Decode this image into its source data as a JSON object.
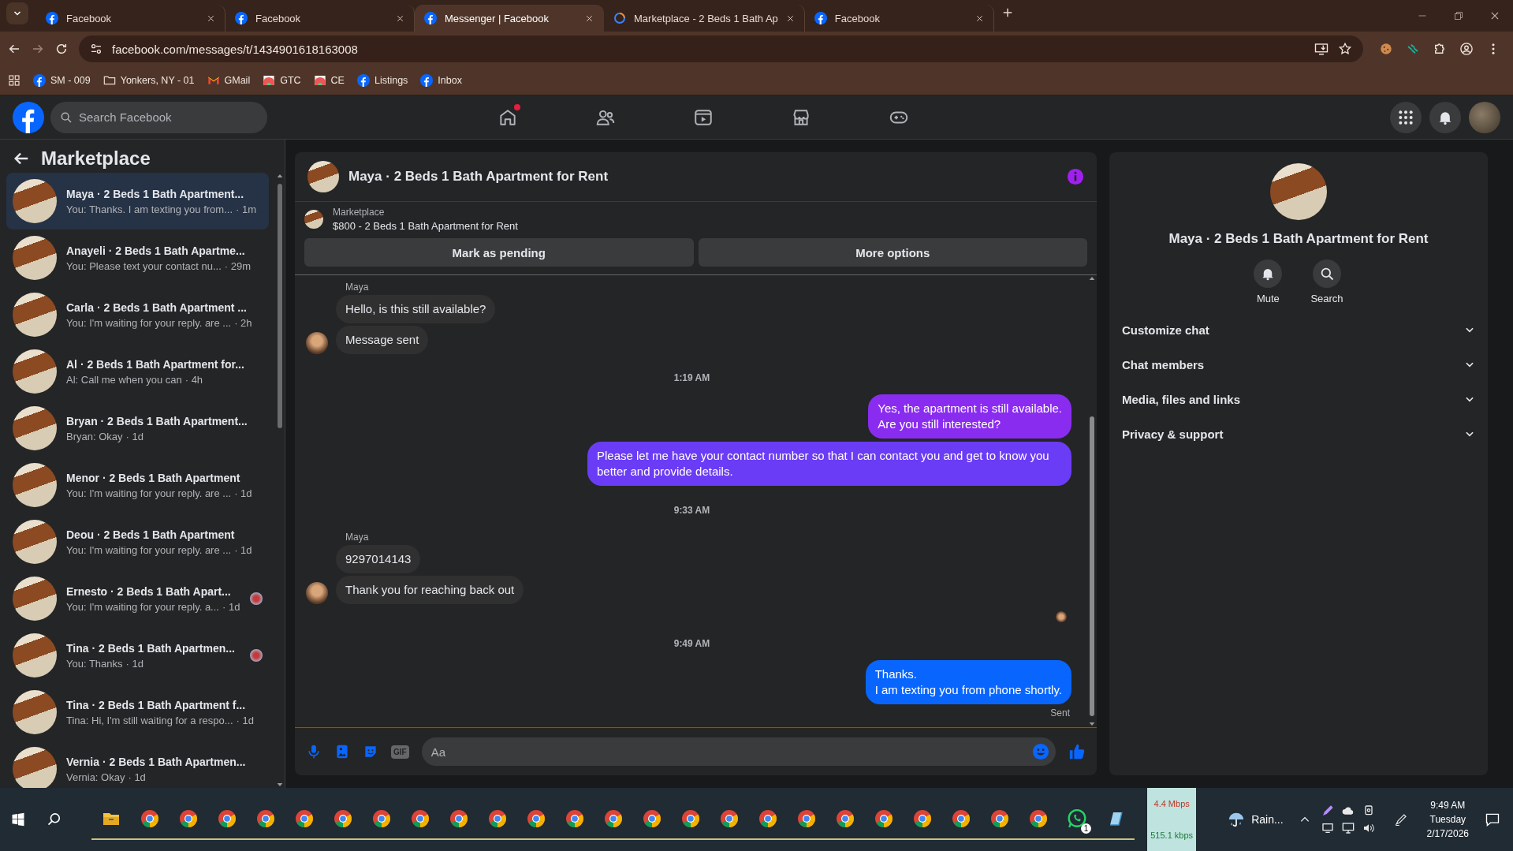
{
  "browser": {
    "tabs": [
      {
        "title": "Facebook",
        "kind": "facebook",
        "selected": false
      },
      {
        "title": "Facebook",
        "kind": "facebook",
        "selected": false
      },
      {
        "title": "Messenger | Facebook",
        "kind": "facebook",
        "selected": true
      },
      {
        "title": "Marketplace - 2 Beds 1 Bath Ap",
        "kind": "loading",
        "selected": false
      },
      {
        "title": "Facebook",
        "kind": "facebook",
        "selected": false
      }
    ],
    "url": "facebook.com/messages/t/1434901618163008",
    "bookmarks": [
      {
        "label": "SM - 009",
        "kind": "facebook"
      },
      {
        "label": "Yonkers, NY - 01",
        "kind": "folder"
      },
      {
        "label": "GMail",
        "kind": "gmail"
      },
      {
        "label": "GTC",
        "kind": "image"
      },
      {
        "label": "CE",
        "kind": "image"
      },
      {
        "label": "Listings",
        "kind": "facebook"
      },
      {
        "label": "Inbox",
        "kind": "facebook"
      }
    ]
  },
  "facebook_header": {
    "search_placeholder": "Search Facebook",
    "nav": [
      {
        "kind": "home",
        "notification_dot": true
      },
      {
        "kind": "friends",
        "notification_dot": false
      },
      {
        "kind": "video",
        "notification_dot": false
      },
      {
        "kind": "marketplace",
        "notification_dot": false
      },
      {
        "kind": "gaming",
        "notification_dot": false
      }
    ]
  },
  "sidebar": {
    "title": "Marketplace",
    "conversations": [
      {
        "title": "Maya · 2 Beds 1 Bath Apartment...",
        "preview": "You: Thanks. I am texting you from...",
        "time": "· 1m",
        "selected": true,
        "seen_avatar": false
      },
      {
        "title": "Anayeli · 2 Beds 1 Bath Apartme...",
        "preview": "You: Please text your contact nu...",
        "time": "· 29m",
        "selected": false,
        "seen_avatar": false
      },
      {
        "title": "Carla · 2 Beds 1 Bath Apartment ...",
        "preview": "You: I'm waiting for your reply. are ...",
        "time": "· 2h",
        "selected": false,
        "seen_avatar": false
      },
      {
        "title": "Al · 2 Beds 1 Bath Apartment for...",
        "preview": "Al: Call me when you can",
        "time": "· 4h",
        "selected": false,
        "seen_avatar": false
      },
      {
        "title": "Bryan · 2 Beds 1 Bath Apartment...",
        "preview": "Bryan: Okay",
        "time": "· 1d",
        "selected": false,
        "seen_avatar": false
      },
      {
        "title": "Menor · 2 Beds 1 Bath Apartment",
        "preview": "You: I'm waiting for your reply. are ...",
        "time": "· 1d",
        "selected": false,
        "seen_avatar": false
      },
      {
        "title": "Deou · 2 Beds 1 Bath Apartment",
        "preview": "You: I'm waiting for your reply. are ...",
        "time": "· 1d",
        "selected": false,
        "seen_avatar": false
      },
      {
        "title": "Ernesto · 2 Beds 1 Bath Apart...",
        "preview": "You: I'm waiting for your reply. a...",
        "time": "· 1d",
        "selected": false,
        "seen_avatar": true
      },
      {
        "title": "Tina · 2 Beds 1 Bath Apartmen...",
        "preview": "You: Thanks",
        "time": "· 1d",
        "selected": false,
        "seen_avatar": true
      },
      {
        "title": "Tina · 2 Beds 1 Bath Apartment f...",
        "preview": "Tina: Hi, I'm still waiting for a respo...",
        "time": "· 1d",
        "selected": false,
        "seen_avatar": false
      },
      {
        "title": "Vernia · 2 Beds 1 Bath Apartmen...",
        "preview": "Vernia: Okay",
        "time": "· 1d",
        "selected": false,
        "seen_avatar": false
      }
    ]
  },
  "chat": {
    "title": "Maya · 2 Beds 1 Bath Apartment for Rent",
    "listing": {
      "label": "Marketplace",
      "title": "$800 - 2 Beds 1 Bath Apartment for Rent"
    },
    "actions": [
      "Mark as pending",
      "More options"
    ],
    "messages": [
      {
        "kind": "sender",
        "text": "Maya"
      },
      {
        "kind": "incoming",
        "text": "Hello, is this still available?",
        "avatar": false
      },
      {
        "kind": "incoming",
        "text": "Message sent",
        "avatar": true
      },
      {
        "kind": "time",
        "text": "1:19 AM"
      },
      {
        "kind": "outgoing",
        "text": "Yes, the apartment is still available.\nAre you still interested?",
        "color": "#8a2cf0"
      },
      {
        "kind": "outgoing",
        "text": "Please let me have your contact number so that I can contact you and get to know you better and provide details.",
        "color": "#6b3cf5"
      },
      {
        "kind": "time",
        "text": "9:33 AM"
      },
      {
        "kind": "sender",
        "text": "Maya"
      },
      {
        "kind": "incoming",
        "text": "9297014143",
        "avatar": false
      },
      {
        "kind": "incoming",
        "text": "Thank you for reaching back out",
        "avatar": true
      },
      {
        "kind": "seen"
      },
      {
        "kind": "time",
        "text": "9:49 AM"
      },
      {
        "kind": "outgoing",
        "text": "Thanks.\nI am texting you from phone shortly.",
        "color": "#0866ff"
      },
      {
        "kind": "status",
        "text": "Sent"
      }
    ],
    "composer": {
      "placeholder": "Aa",
      "gif_label": "GIF"
    }
  },
  "details": {
    "title": "Maya · 2 Beds 1 Bath Apartment for Rent",
    "actions": [
      {
        "kind": "mute",
        "label": "Mute"
      },
      {
        "kind": "search",
        "label": "Search"
      }
    ],
    "sections": [
      {
        "label": "Customize chat",
        "expanded": false
      },
      {
        "label": "Chat members",
        "expanded": false
      },
      {
        "label": "Media, files and links",
        "expanded": false
      },
      {
        "label": "Privacy & support",
        "expanded": false
      }
    ]
  },
  "taskbar": {
    "apps": [
      {
        "kind": "folder"
      },
      {
        "kind": "browser"
      },
      {
        "kind": "browser"
      },
      {
        "kind": "browser"
      },
      {
        "kind": "browser"
      },
      {
        "kind": "browser"
      },
      {
        "kind": "browser"
      },
      {
        "kind": "browser"
      },
      {
        "kind": "browser"
      },
      {
        "kind": "browser"
      },
      {
        "kind": "browser"
      },
      {
        "kind": "browser"
      },
      {
        "kind": "browser"
      },
      {
        "kind": "browser"
      },
      {
        "kind": "browser"
      },
      {
        "kind": "browser"
      },
      {
        "kind": "browser"
      },
      {
        "kind": "browser"
      },
      {
        "kind": "browser"
      },
      {
        "kind": "browser"
      },
      {
        "kind": "browser"
      },
      {
        "kind": "browser"
      },
      {
        "kind": "browser"
      },
      {
        "kind": "browser"
      },
      {
        "kind": "browser"
      },
      {
        "kind": "chat",
        "badge": "1"
      },
      {
        "kind": "notes"
      }
    ],
    "network": {
      "down": "4.4 Mbps",
      "up": "515.1 kbps"
    },
    "weather": "Rain...",
    "clock": {
      "time": "9:49 AM",
      "day": "Tuesday",
      "date": "2/17/2026"
    }
  }
}
